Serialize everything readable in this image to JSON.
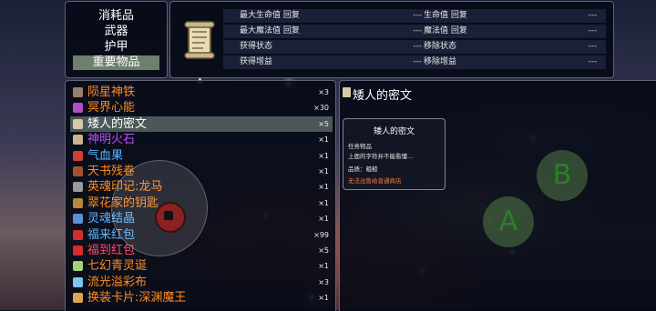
{
  "categories": [
    "消耗品",
    "武器",
    "护甲",
    "重要物品"
  ],
  "selected_category": 3,
  "stats": [
    {
      "label": "最大生命值 回复",
      "dash": "---",
      "label2": "生命值 回复"
    },
    {
      "label": "最大魔法值 回复",
      "dash": "---",
      "label2": "魔法值 回复"
    },
    {
      "label": "获得状态",
      "dash": "---",
      "label2": "移除状态"
    },
    {
      "label": "获得增益",
      "dash": "---",
      "label2": "移除增益"
    }
  ],
  "items": [
    {
      "name": "陨星神铁",
      "qty": "×3",
      "color": "#ff8b1f",
      "icon_color": "#9a7f6a"
    },
    {
      "name": "冥界心能",
      "qty": "×30",
      "color": "#ff8b1f",
      "icon_color": "#b050c0"
    },
    {
      "name": "矮人的密文",
      "qty": "×5",
      "color": "#ffffff",
      "icon_color": "#d7c9a4"
    },
    {
      "name": "神明火石",
      "qty": "×1",
      "color": "#b84fff",
      "icon_color": "#c7b58c"
    },
    {
      "name": "气血果",
      "qty": "×1",
      "color": "#5ab4ff",
      "icon_color": "#d0402e"
    },
    {
      "name": "天书残卷",
      "qty": "×1",
      "color": "#ff8b1f",
      "icon_color": "#a8502e"
    },
    {
      "name": "英魂印记:龙马",
      "qty": "×1",
      "color": "#ff8b1f",
      "icon_color": "#9a9a9a"
    },
    {
      "name": "翠花家的钥匙",
      "qty": "×1",
      "color": "#ff8b1f",
      "icon_color": "#b48a3a"
    },
    {
      "name": "灵魂结晶",
      "qty": "×1",
      "color": "#5ab4ff",
      "icon_color": "#5f8fd6"
    },
    {
      "name": "福来红包",
      "qty": "×99",
      "color": "#5ab4ff",
      "icon_color": "#d42d2d"
    },
    {
      "name": "福到红包",
      "qty": "×5",
      "color": "#ff4a6a",
      "icon_color": "#d42d2d"
    },
    {
      "name": "七幻青灵诞",
      "qty": "×1",
      "color": "#ff8b1f",
      "icon_color": "#a8d07a"
    },
    {
      "name": "流光溢彩布",
      "qty": "×3",
      "color": "#ff8b1f",
      "icon_color": "#7fc4ea"
    },
    {
      "name": "换装卡片:深渊魔王",
      "qty": "×1",
      "color": "#ff8b1f",
      "icon_color": "#d8a850"
    }
  ],
  "selected_item": 2,
  "detail": {
    "title": "矮人的密文",
    "tip_title": "矮人的密文",
    "tip_type": "任务物品",
    "tip_desc": "上面的字符并不能看懂...",
    "tip_quality": "品质：粗糙",
    "tip_note": "无法出售给普通商店",
    "tip_note_color": "#ff7a3a"
  },
  "buttons": {
    "a": "A",
    "b": "B"
  }
}
